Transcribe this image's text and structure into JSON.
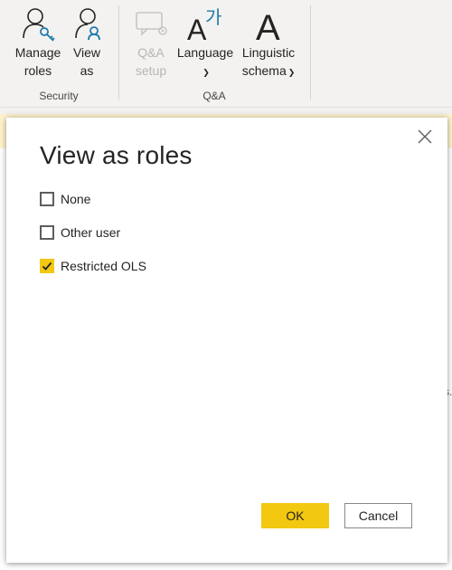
{
  "ribbon": {
    "groups": [
      {
        "label": "Security",
        "buttons": [
          {
            "label_line1": "Manage",
            "label_line2": "roles",
            "icon": "manage-roles-icon"
          },
          {
            "label_line1": "View",
            "label_line2": "as",
            "icon": "view-as-icon"
          }
        ]
      },
      {
        "label": "Q&A",
        "buttons": [
          {
            "label_line1": "Q&A",
            "label_line2": "setup",
            "icon": "qa-setup-icon",
            "disabled": true
          },
          {
            "label_line1": "Language",
            "label_line2": "",
            "icon": "language-icon",
            "has_dropdown": true
          },
          {
            "label_line1": "Linguistic",
            "label_line2": "schema",
            "icon": "linguistic-schema-icon",
            "has_dropdown": true
          }
        ]
      }
    ]
  },
  "icon_text": {
    "language_latin": "A",
    "language_korean": "가",
    "linguistic": "A"
  },
  "background": {
    "peek_text": "s."
  },
  "dialog": {
    "title": "View as roles",
    "options": [
      {
        "label": "None",
        "checked": false
      },
      {
        "label": "Other user",
        "checked": false
      },
      {
        "label": "Restricted OLS",
        "checked": true
      }
    ],
    "ok_label": "OK",
    "cancel_label": "Cancel"
  },
  "colors": {
    "accent_yellow": "#f2c811",
    "infobar": "#fff4ce",
    "icon_teal": "#1e7aa8"
  }
}
